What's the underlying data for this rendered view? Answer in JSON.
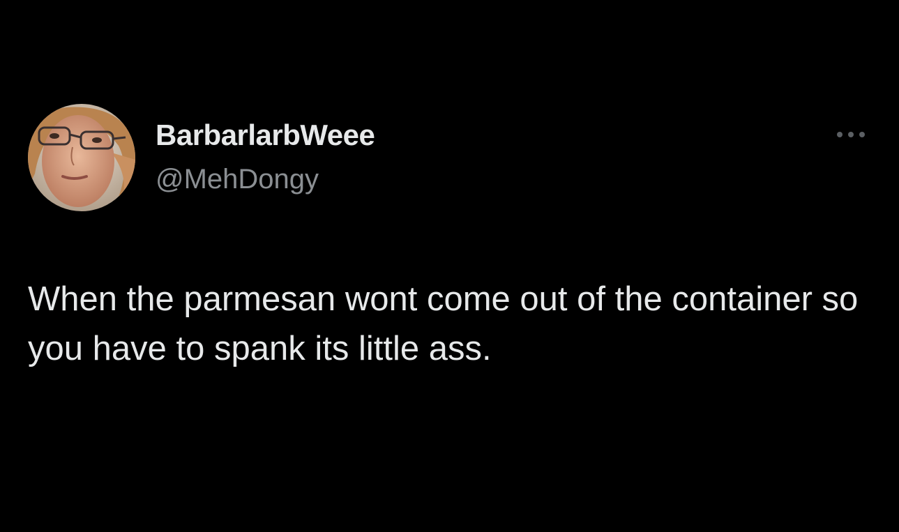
{
  "tweet": {
    "author": {
      "display_name": "BarbarlarbWeee",
      "handle": "@MehDongy",
      "avatar_icon": "profile-photo"
    },
    "menu_icon": "more-horizontal-icon",
    "text": "When the parmesan wont come out of the container so you have to spank its little ass."
  },
  "colors": {
    "background": "#000000",
    "primary_text": "#e7e9ea",
    "secondary_text": "#8b8f93"
  }
}
